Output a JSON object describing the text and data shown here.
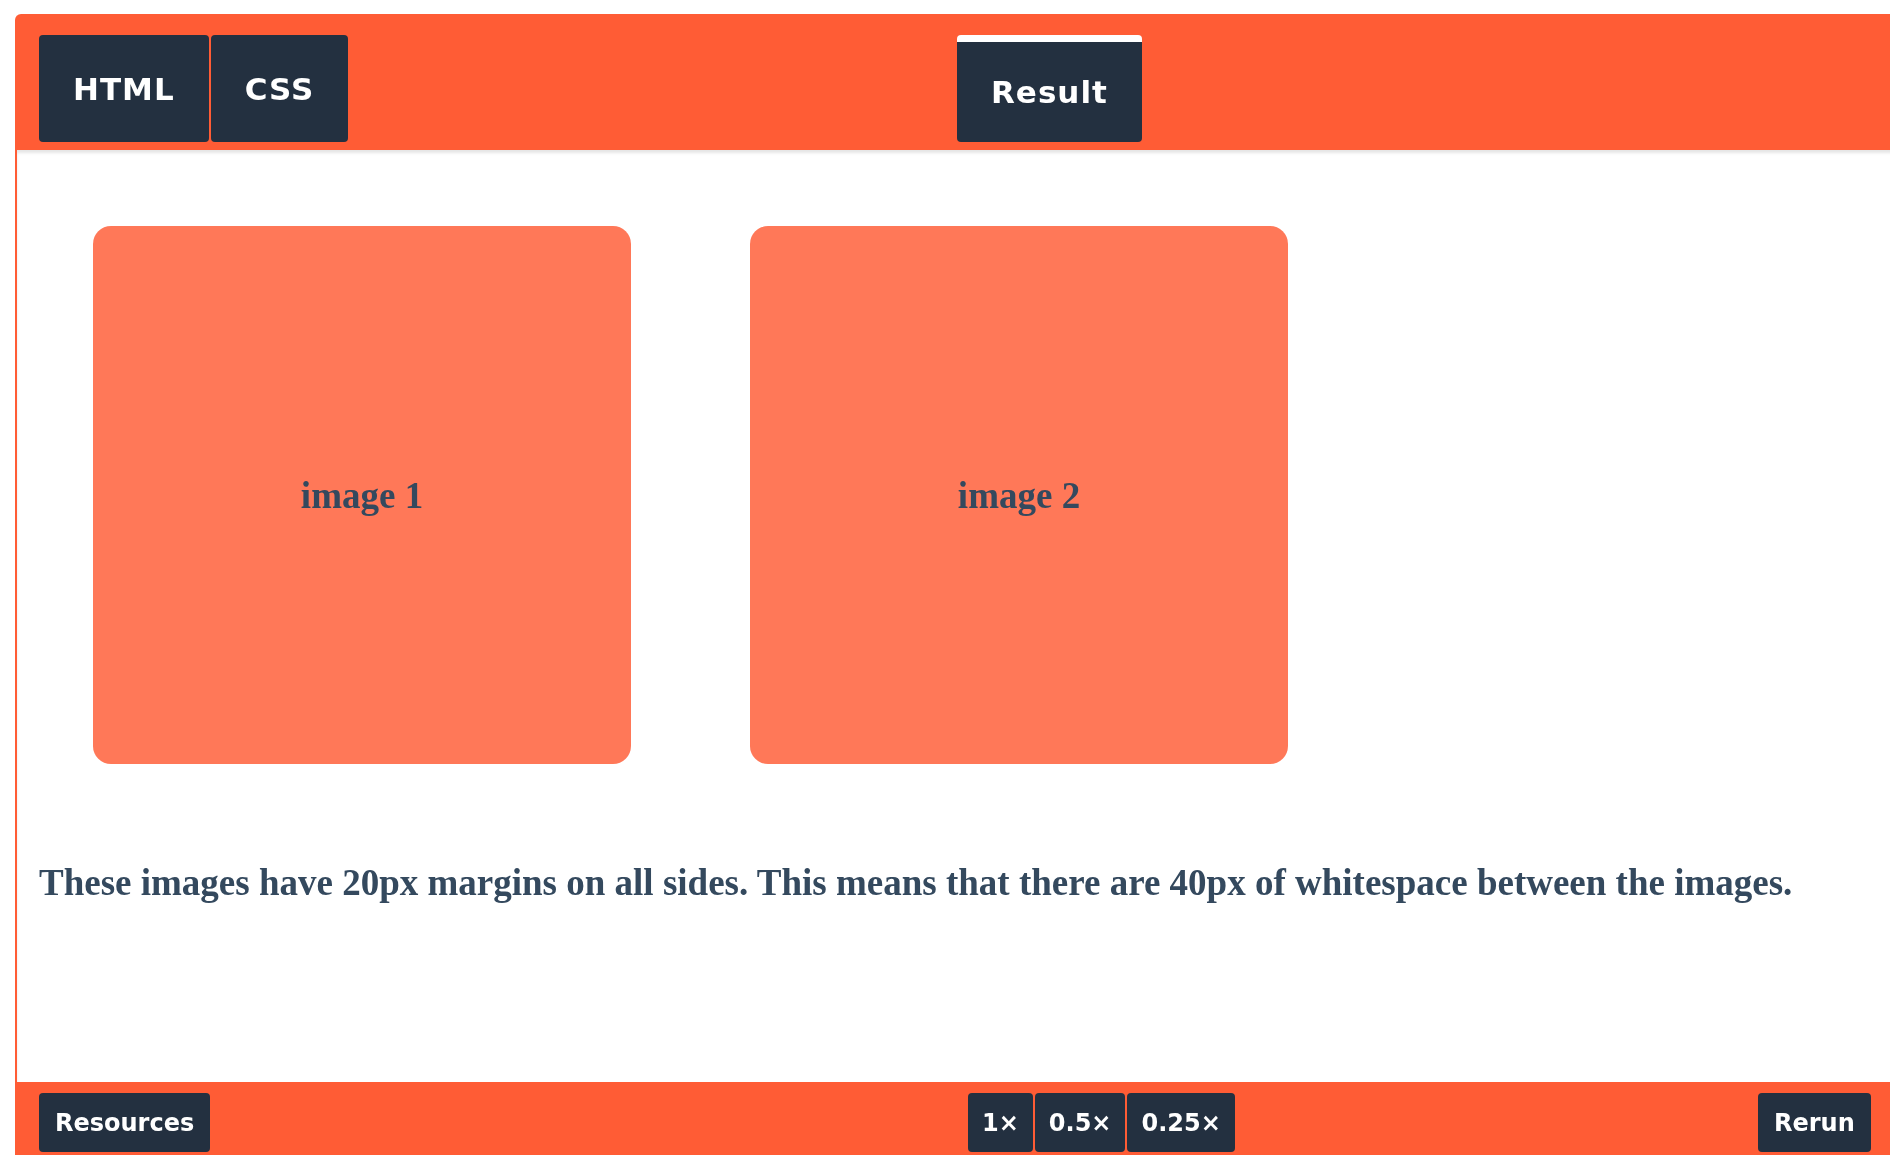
{
  "tabs": [
    {
      "label": "HTML",
      "selected": false
    },
    {
      "label": "CSS",
      "selected": false
    },
    {
      "label": "Result",
      "selected": true
    }
  ],
  "result": {
    "boxes": [
      {
        "label": "image 1"
      },
      {
        "label": "image 2"
      }
    ],
    "paragraph": "These images have 20px margins on all sides. This means that there are 40px of whitespace between the images."
  },
  "footer": {
    "resources": "Resources",
    "zoom": [
      "1×",
      "0.5×",
      "0.25×"
    ],
    "rerun": "Rerun"
  }
}
